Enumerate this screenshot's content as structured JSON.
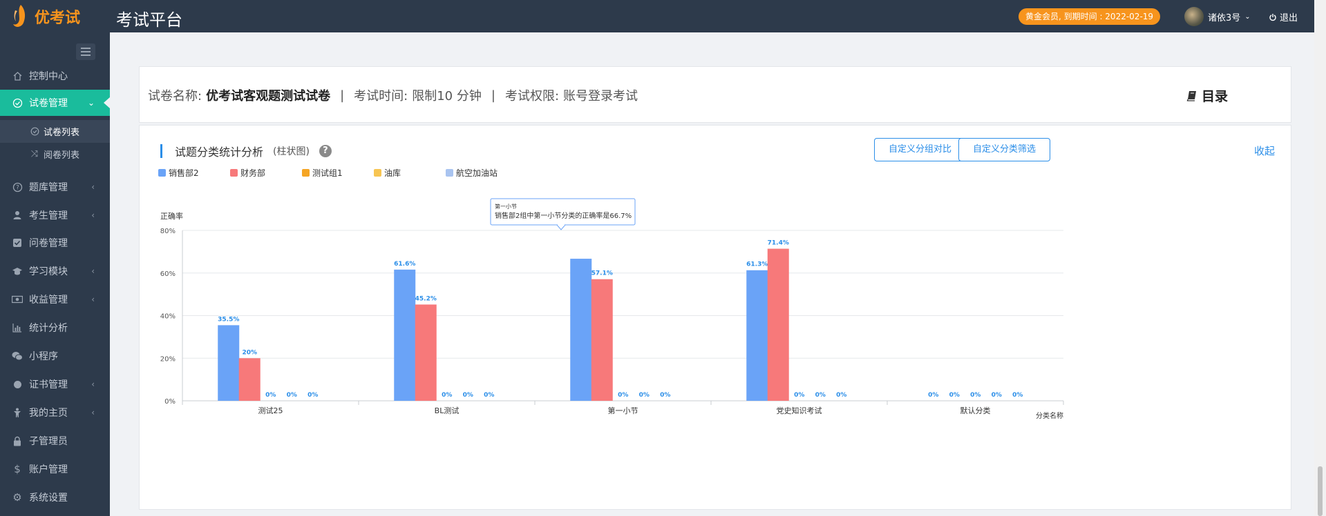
{
  "topbar": {
    "logo_text": "优考试",
    "title": "考试平台",
    "membership": "黄金会员, 到期时间 : 2022-02-19",
    "username": "诸依3号",
    "logout": "退出"
  },
  "sidebar": {
    "items": [
      {
        "label": "控制中心",
        "icon": "home-icon"
      },
      {
        "label": "试卷管理",
        "icon": "check-circle-icon",
        "active": true
      },
      {
        "label": "题库管理",
        "icon": "question-circle-icon"
      },
      {
        "label": "考生管理",
        "icon": "user-icon"
      },
      {
        "label": "问卷管理",
        "icon": "checkbox-icon"
      },
      {
        "label": "学习模块",
        "icon": "graduation-cap-icon"
      },
      {
        "label": "收益管理",
        "icon": "money-icon"
      },
      {
        "label": "统计分析",
        "icon": "bar-chart-icon"
      },
      {
        "label": "小程序",
        "icon": "wechat-icon"
      },
      {
        "label": "证书管理",
        "icon": "circle-icon"
      },
      {
        "label": "我的主页",
        "icon": "child-icon"
      },
      {
        "label": "子管理员",
        "icon": "lock-icon"
      },
      {
        "label": "账户管理",
        "icon": "dollar-icon"
      },
      {
        "label": "系统设置",
        "icon": "gear-icon"
      }
    ],
    "subitems": [
      {
        "label": "试卷列表",
        "icon": "check-circle-icon",
        "active": true
      },
      {
        "label": "阅卷列表",
        "icon": "shuffle-icon"
      }
    ]
  },
  "paper": {
    "name_label": "试卷名称:",
    "name": "优考试客观题测试试卷",
    "time_label": "考试时间:",
    "time": "限制10 分钟",
    "permission_label": "考试权限:",
    "permission": "账号登录考试",
    "toc": "目录"
  },
  "panel": {
    "title": "试题分类统计分析",
    "hint": "(柱状图)",
    "help": "?",
    "btn_group_compare": "自定义分组对比",
    "btn_category_filter": "自定义分类筛选",
    "collapse": "收起"
  },
  "colors": {
    "accent": "#2b8ee8",
    "sidebar_bg": "#2d3a4b",
    "active_menu": "#1abc9c",
    "badge": "#f7941d"
  },
  "chart_data": {
    "type": "bar",
    "ylabel": "正确率",
    "xlabel": "分类名称",
    "ylim": [
      0,
      80
    ],
    "yticks": [
      "0%",
      "20%",
      "40%",
      "60%",
      "80%"
    ],
    "categories": [
      "测试25",
      "BL测试",
      "第一小节",
      "党史知识考试",
      "默认分类"
    ],
    "series": [
      {
        "name": "销售部2",
        "color": "#6aa3f7",
        "values": [
          35.5,
          61.6,
          66.7,
          61.3,
          0
        ],
        "labels": [
          "35.5%",
          "61.6%",
          "",
          "61.3%",
          "0%"
        ]
      },
      {
        "name": "财务部",
        "color": "#f7797a",
        "values": [
          20,
          45.2,
          57.1,
          71.4,
          0
        ],
        "labels": [
          "20%",
          "45.2%",
          "57.1%",
          "71.4%",
          "0%"
        ]
      },
      {
        "name": "测试组1",
        "color": "#f5a524",
        "values": [
          0,
          0,
          0,
          0,
          0
        ],
        "labels": [
          "0%",
          "0%",
          "0%",
          "0%",
          "0%"
        ]
      },
      {
        "name": "油库",
        "color": "#f7c552",
        "values": [
          0,
          0,
          0,
          0,
          0
        ],
        "labels": [
          "0%",
          "0%",
          "0%",
          "0%",
          "0%"
        ]
      },
      {
        "name": "航空加油站",
        "color": "#a9c4f0",
        "values": [
          0,
          0,
          0,
          0,
          0
        ],
        "labels": [
          "0%",
          "0%",
          "0%",
          "0%",
          "0%"
        ]
      }
    ],
    "grid": true,
    "legend": "top-left",
    "tooltip": {
      "title": "第一小节",
      "text": "销售部2组中第一小节分类的正确率是66.7%"
    }
  }
}
